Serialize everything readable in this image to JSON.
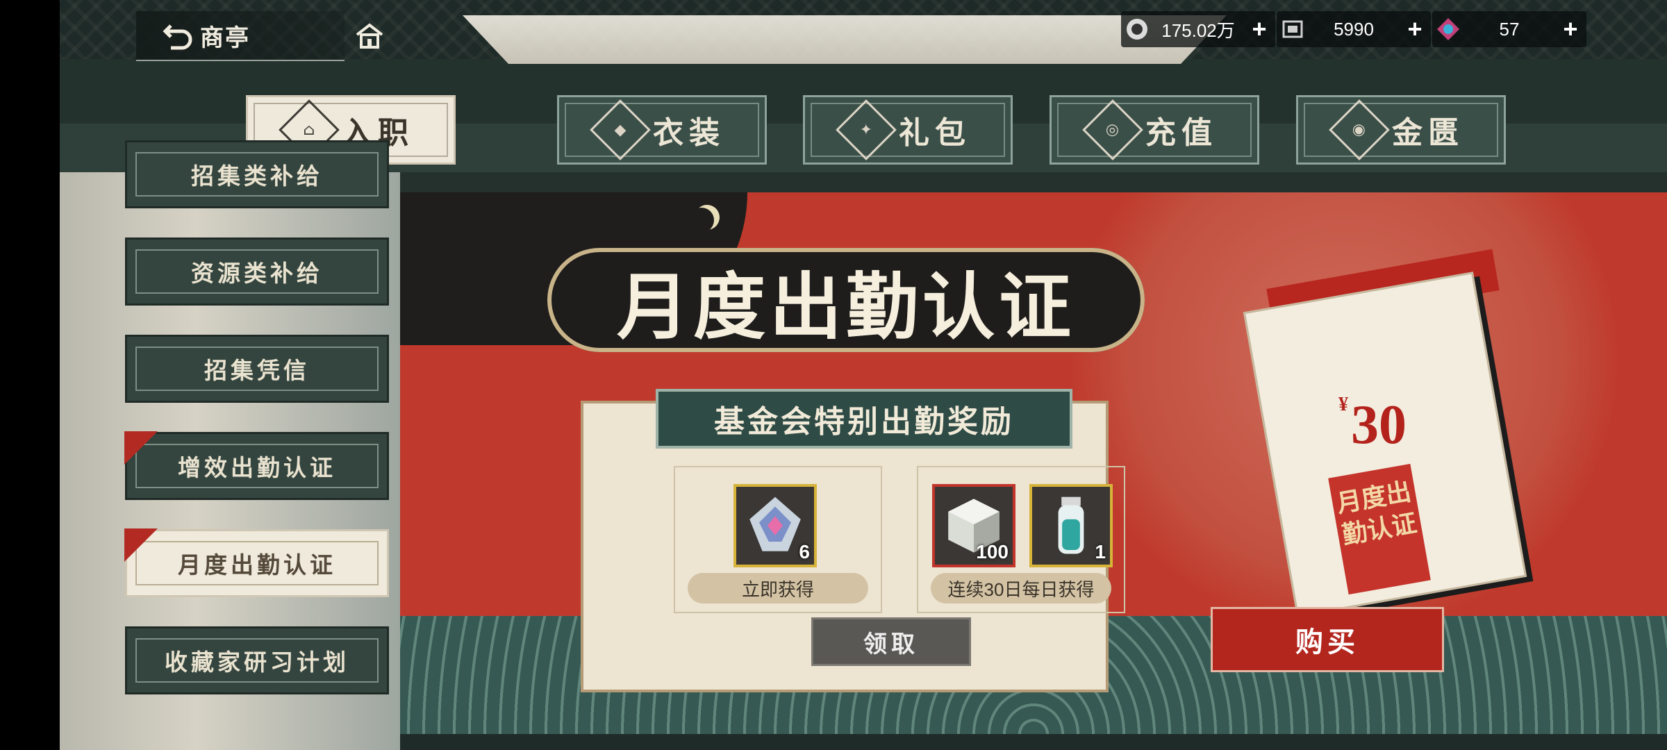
{
  "header": {
    "back_label": "商亭",
    "currencies": [
      {
        "icon": "coin-icon",
        "value": "175.02万",
        "plus": "+"
      },
      {
        "icon": "ticket-icon",
        "value": "5990",
        "plus": "+"
      },
      {
        "icon": "crystal-icon",
        "value": "57",
        "plus": "+"
      }
    ]
  },
  "tabs": [
    {
      "label": "入职",
      "icon": "house-badge-icon",
      "active": true
    },
    {
      "label": "衣装",
      "icon": "outfit-badge-icon",
      "active": false
    },
    {
      "label": "礼包",
      "icon": "gift-badge-icon",
      "active": false
    },
    {
      "label": "充值",
      "icon": "recharge-badge-icon",
      "active": false
    },
    {
      "label": "金匮",
      "icon": "vault-badge-icon",
      "active": false
    }
  ],
  "sidebar": {
    "items": [
      {
        "label": "招集类补给"
      },
      {
        "label": "资源类补给"
      },
      {
        "label": "招集凭信"
      },
      {
        "label": "增效出勤认证"
      },
      {
        "label": "月度出勤认证"
      },
      {
        "label": "收藏家研习计划"
      }
    ]
  },
  "panel": {
    "title": "月度出勤认证",
    "card_title": "基金会特别出勤奖励",
    "instant": {
      "tag": "立即获得",
      "items": [
        {
          "icon": "prism-crystal-icon",
          "count": "6"
        }
      ]
    },
    "daily": {
      "tag": "连续30日每日获得",
      "items": [
        {
          "icon": "cube-crystal-icon",
          "count": "100"
        },
        {
          "icon": "vial-icon",
          "count": "1"
        }
      ]
    },
    "claim_label": "领取",
    "calendar": {
      "currency": "¥",
      "price": "30",
      "stamp": "月度出勤认证"
    },
    "buy_label": "购买"
  },
  "colors": {
    "accent_red": "#bf3a2c",
    "panel_green": "#2f4b46",
    "cream": "#efe9dc"
  }
}
